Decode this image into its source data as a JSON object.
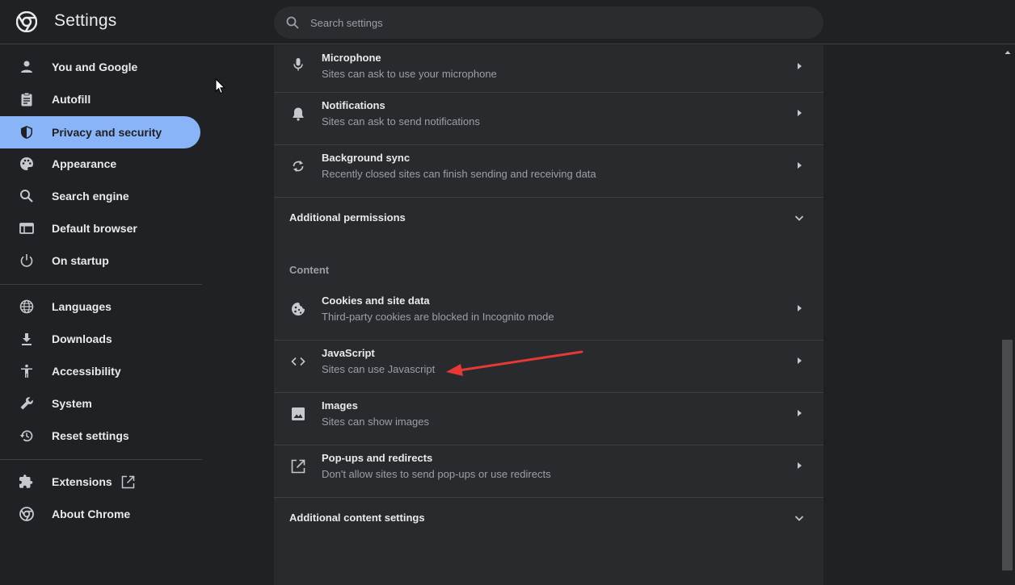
{
  "header": {
    "title": "Settings",
    "search_placeholder": "Search settings"
  },
  "sidebar": {
    "items": [
      {
        "label": "You and Google",
        "icon": "person-icon"
      },
      {
        "label": "Autofill",
        "icon": "clipboard-icon"
      },
      {
        "label": "Privacy and security",
        "icon": "shield-icon",
        "active": true
      },
      {
        "label": "Appearance",
        "icon": "palette-icon"
      },
      {
        "label": "Search engine",
        "icon": "search-icon"
      },
      {
        "label": "Default browser",
        "icon": "browser-window-icon"
      },
      {
        "label": "On startup",
        "icon": "power-icon"
      },
      {
        "label": "Languages",
        "icon": "globe-icon"
      },
      {
        "label": "Downloads",
        "icon": "download-icon"
      },
      {
        "label": "Accessibility",
        "icon": "accessibility-icon"
      },
      {
        "label": "System",
        "icon": "wrench-icon"
      },
      {
        "label": "Reset settings",
        "icon": "restore-icon"
      },
      {
        "label": "Extensions",
        "icon": "puzzle-icon"
      },
      {
        "label": "About Chrome",
        "icon": "chrome-icon"
      }
    ]
  },
  "permissions": [
    {
      "title": "Microphone",
      "subtitle": "Sites can ask to use your microphone",
      "icon": "microphone-icon"
    },
    {
      "title": "Notifications",
      "subtitle": "Sites can ask to send notifications",
      "icon": "bell-icon"
    },
    {
      "title": "Background sync",
      "subtitle": "Recently closed sites can finish sending and receiving data",
      "icon": "sync-icon"
    }
  ],
  "additional_permissions": "Additional permissions",
  "content_section_label": "Content",
  "content": [
    {
      "title": "Cookies and site data",
      "subtitle": "Third-party cookies are blocked in Incognito mode",
      "icon": "cookie-icon"
    },
    {
      "title": "JavaScript",
      "subtitle": "Sites can use Javascript",
      "icon": "code-icon"
    },
    {
      "title": "Images",
      "subtitle": "Sites can show images",
      "icon": "image-icon"
    },
    {
      "title": "Pop-ups and redirects",
      "subtitle": "Don't allow sites to send pop-ups or use redirects",
      "icon": "open-external-icon"
    }
  ],
  "additional_content_settings": "Additional content settings",
  "colors": {
    "background": "#202124",
    "panel": "#292a2d",
    "accent": "#8ab4f8",
    "annotation": "#e53935"
  }
}
